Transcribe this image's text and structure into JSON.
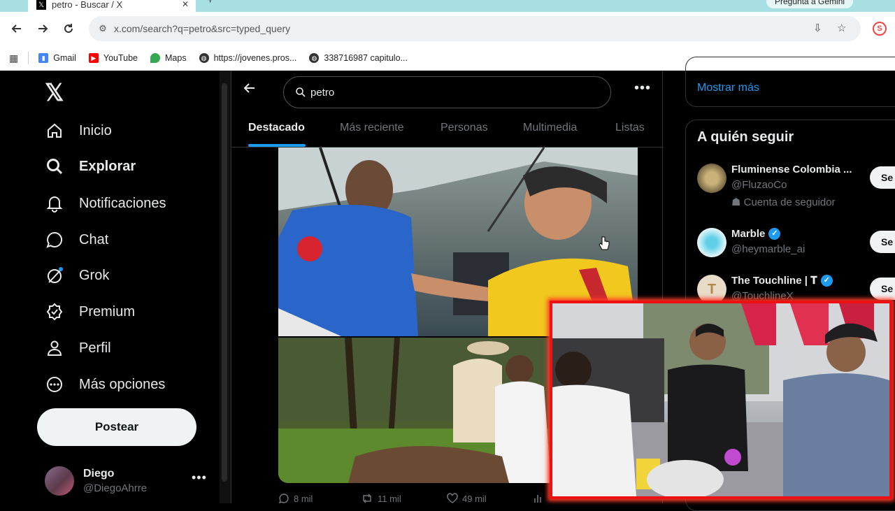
{
  "browser": {
    "tab_title": "petro - Buscar / X",
    "gemini_label": "Pregunta a Gemini",
    "url": "x.com/search?q=petro&src=typed_query",
    "bookmarks": [
      {
        "label": "Gmail",
        "icon": "gmail-icon"
      },
      {
        "label": "YouTube",
        "icon": "youtube-icon"
      },
      {
        "label": "Maps",
        "icon": "maps-icon"
      },
      {
        "label": "https://jovenes.pros...",
        "icon": "globe-icon"
      },
      {
        "label": "338716987 capitulo...",
        "icon": "globe-icon"
      }
    ]
  },
  "nav": {
    "items": [
      {
        "label": "Inicio",
        "icon": "home-icon"
      },
      {
        "label": "Explorar",
        "icon": "search-icon"
      },
      {
        "label": "Notificaciones",
        "icon": "bell-icon"
      },
      {
        "label": "Chat",
        "icon": "chat-icon"
      },
      {
        "label": "Grok",
        "icon": "grok-icon"
      },
      {
        "label": "Premium",
        "icon": "premium-icon"
      },
      {
        "label": "Perfil",
        "icon": "profile-icon"
      },
      {
        "label": "Más opciones",
        "icon": "more-options-icon"
      }
    ],
    "post_label": "Postear",
    "user": {
      "name": "Diego",
      "handle": "@DiegoAhrre"
    }
  },
  "search": {
    "query": "petro",
    "tabs": [
      "Destacado",
      "Más reciente",
      "Personas",
      "Multimedia",
      "Listas"
    ],
    "active_tab": "Destacado"
  },
  "post": {
    "replies": "8 mil",
    "reposts": "11 mil",
    "likes": "49 mil"
  },
  "sidebar": {
    "show_more": "Mostrar más",
    "who_to_follow_title": "A quién seguir",
    "follow_label": "Se",
    "accounts": [
      {
        "name": "Fluminense Colombia ...",
        "handle": "@FluzaoCo",
        "sub": "Cuenta de seguidor",
        "verified": false
      },
      {
        "name": "Marble",
        "handle": "@heymarble_ai",
        "verified": true
      },
      {
        "name": "The Touchline | 𝐓",
        "handle": "@TouchlineX",
        "verified": true
      }
    ]
  },
  "colors": {
    "accent": "#1d9bf0",
    "background": "#000000",
    "webcam_border": "#ff2a1a"
  }
}
